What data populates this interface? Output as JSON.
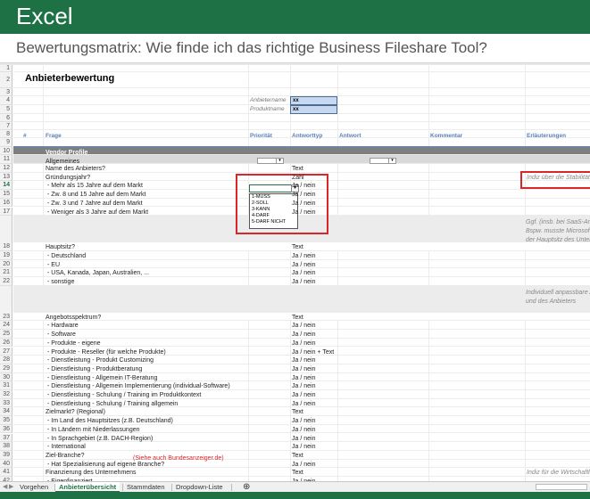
{
  "banner": {
    "title": "Excel"
  },
  "subtitle": "Bewertungsmatrix: Wie finde ich das richtige Business Fileshare Tool?",
  "sheet": {
    "title": "Anbieterbewertung",
    "anbieter_label": "Anbietername",
    "anbieter_value": "xx",
    "produkt_label": "Produktname",
    "produkt_value": "xx",
    "headers": {
      "nr": "#",
      "frage": "Frage",
      "prioritaet": "Priorität",
      "antworttyp": "Antworttyp",
      "antwort": "Antwort",
      "kommentar": "Kommentar",
      "erlaeuterungen": "Erläuterungen"
    },
    "section_vendor": "Vendor Profile",
    "section_allgemeines": "Allgemeines",
    "rows": [
      {
        "n": "12",
        "frage": "Name des Anbieters?",
        "typ": "Text",
        "erl": ""
      },
      {
        "n": "13",
        "frage": "Gründungsjahr?",
        "typ": "Zahl",
        "erl": "Indiz über die Stabilität d"
      },
      {
        "n": "14",
        "frage": "- Mehr als 15 Jahre auf dem Markt",
        "typ": "Ja / nein",
        "erl": ""
      },
      {
        "n": "15",
        "frage": "- Zw. 8 und 15 Jahre auf dem Markt",
        "typ": "Ja / nein",
        "erl": ""
      },
      {
        "n": "16",
        "frage": "- Zw. 3 und 7 Jahre auf dem Markt",
        "typ": "Ja / nein",
        "erl": ""
      },
      {
        "n": "17",
        "frage": "- Weniger als 3 Jahre auf dem Markt",
        "typ": "Ja / nein",
        "erl": ""
      },
      {
        "n": "18",
        "frage": "Hauptsitz?",
        "typ": "Text",
        "erl": ""
      },
      {
        "n": "19",
        "frage": "- Deutschland",
        "typ": "Ja / nein",
        "erl": ""
      },
      {
        "n": "20",
        "frage": "- EU",
        "typ": "Ja / nein",
        "erl": ""
      },
      {
        "n": "21",
        "frage": "- USA, Kanada, Japan, Australien, ...",
        "typ": "Ja / nein",
        "erl": ""
      },
      {
        "n": "22",
        "frage": "- sonstige",
        "typ": "Ja / nein",
        "erl": ""
      },
      {
        "n": "23",
        "frage": "Angebotsspektrum?",
        "typ": "Text",
        "erl": ""
      },
      {
        "n": "24",
        "frage": "- Hardware",
        "typ": "Ja / nein",
        "erl": ""
      },
      {
        "n": "25",
        "frage": "- Software",
        "typ": "Ja / nein",
        "erl": ""
      },
      {
        "n": "26",
        "frage": "- Produkte - eigene",
        "typ": "Ja / nein",
        "erl": ""
      },
      {
        "n": "27",
        "frage": "- Produkte - Reseller (für welche Produkte)",
        "typ": "Ja / nein + Text",
        "erl": ""
      },
      {
        "n": "28",
        "frage": "- Dienstleistung - Produkt Customizing",
        "typ": "Ja / nein",
        "erl": ""
      },
      {
        "n": "29",
        "frage": "- Dienstleistung - Produktberatung",
        "typ": "Ja / nein",
        "erl": ""
      },
      {
        "n": "30",
        "frage": "- Dienstleistung - Allgemein IT-Beratung",
        "typ": "Ja / nein",
        "erl": ""
      },
      {
        "n": "31",
        "frage": "- Dienstleistung - Allgemein Implementierung (individual-Software)",
        "typ": "Ja / nein",
        "erl": ""
      },
      {
        "n": "32",
        "frage": "- Dienstleistung - Schulung / Training im Produktkontext",
        "typ": "Ja / nein",
        "erl": ""
      },
      {
        "n": "33",
        "frage": "- Dienstleistung - Schulung / Training allgemein",
        "typ": "Ja / nein",
        "erl": ""
      },
      {
        "n": "34",
        "frage": "Zielmarkt? (Regional)",
        "typ": "Text",
        "erl": ""
      },
      {
        "n": "35",
        "frage": "- Im Land des Hauptsitzes (z.B. Deutschland)",
        "typ": "Ja / nein",
        "erl": ""
      },
      {
        "n": "36",
        "frage": "- In Ländern mit Niederlassungen",
        "typ": "Ja / nein",
        "erl": ""
      },
      {
        "n": "37",
        "frage": "- In Sprachgebiet (z.B. DACH-Region)",
        "typ": "Ja / nein",
        "erl": ""
      },
      {
        "n": "38",
        "frage": "- International",
        "typ": "Ja / nein",
        "erl": ""
      },
      {
        "n": "39",
        "frage": "Ziel-Branche?",
        "typ": "Text",
        "erl": ""
      },
      {
        "n": "40",
        "frage": "- Hat Spezialisierung auf eigene Branche?",
        "typ": "Ja / nein",
        "erl": ""
      },
      {
        "n": "41",
        "frage": "Finanzierung des Unternehmens",
        "typ": "Text",
        "erl": "Indiz für die Wirtschaftlic"
      },
      {
        "n": "42",
        "frage": "- Eigenfinanziert",
        "typ": "Ja / nein",
        "erl": ""
      },
      {
        "n": "43",
        "frage": "- Fremdfinanziert",
        "typ": "Ja / nein",
        "erl": ""
      }
    ],
    "red_note": "(Siehe auch Bundesanzeiger.de)",
    "note_18a": "Ggf. (insb. bei SaaS-Ange",
    "note_18b": "Bspw. musste Microsoft D",
    "note_18c": "der Hauptsitz des Untern",
    "note_23a": "Individuell anpassbare An",
    "note_23b": "und des Anbieters",
    "dropdown_options": [
      "1-MUSS",
      "2-SOLL",
      "3-KANN",
      "4-DARF",
      "5-DARF NICHT"
    ]
  },
  "tabs": [
    {
      "label": "Vorgehen",
      "active": false
    },
    {
      "label": "Anbieterübersicht",
      "active": true
    },
    {
      "label": "Stammdaten",
      "active": false
    },
    {
      "label": "Dropdown-Liste",
      "active": false
    }
  ],
  "add_sheet_icon": "plus-icon",
  "colors": {
    "accent": "#1e7145",
    "highlight": "#d9262a"
  }
}
